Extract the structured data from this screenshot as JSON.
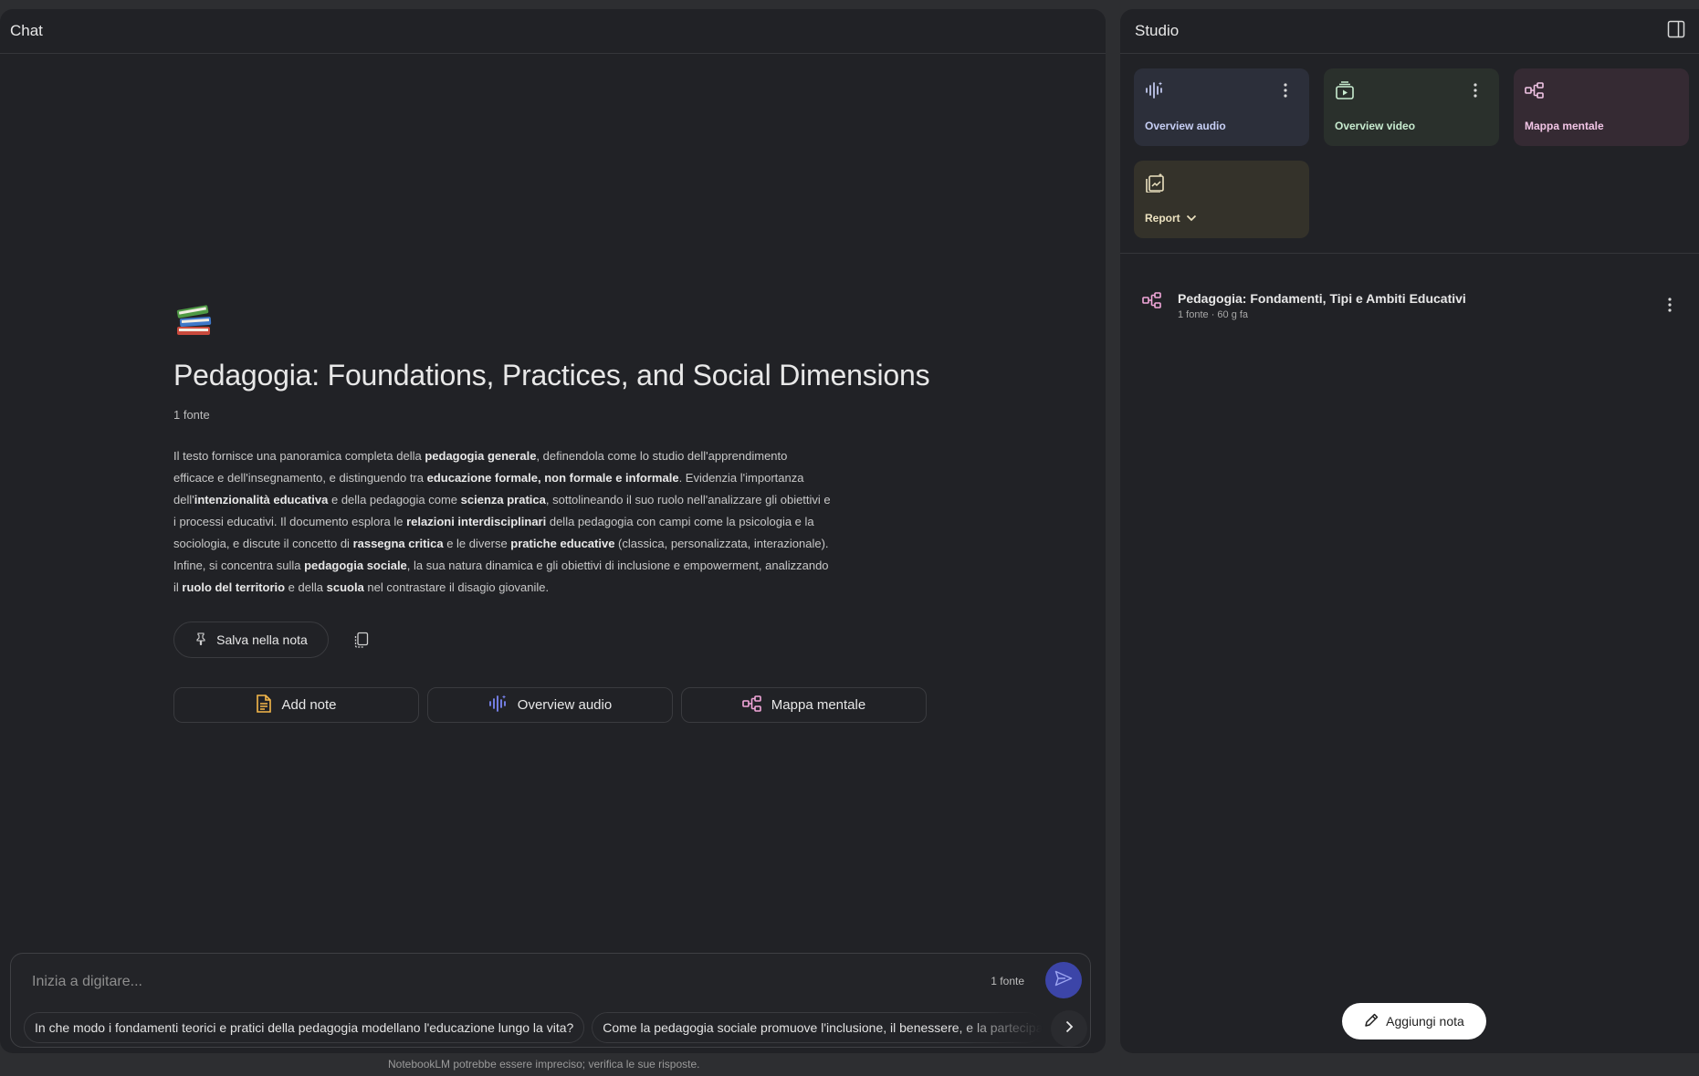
{
  "chat": {
    "header_title": "Chat",
    "notebook_title": "Pedagogia: Foundations, Practices, and Social Dimensions",
    "source_count": "1 fonte",
    "summary": [
      {
        "t": "Il testo fornisce una panoramica completa della ",
        "b": false
      },
      {
        "t": "pedagogia generale",
        "b": true
      },
      {
        "t": ", definendola come lo studio dell'apprendimento efficace e dell'insegnamento, e distinguendo tra ",
        "b": false
      },
      {
        "t": "educazione formale, non formale e informale",
        "b": true
      },
      {
        "t": ". Evidenzia l'importanza dell'",
        "b": false
      },
      {
        "t": "intenzionalità educativa",
        "b": true
      },
      {
        "t": " e della pedagogia come ",
        "b": false
      },
      {
        "t": "scienza pratica",
        "b": true
      },
      {
        "t": ", sottolineando il suo ruolo nell'analizzare gli obiettivi e i processi educativi. Il documento esplora le ",
        "b": false
      },
      {
        "t": "relazioni interdisciplinari",
        "b": true
      },
      {
        "t": " della pedagogia con campi come la psicologia e la sociologia, e discute il concetto di ",
        "b": false
      },
      {
        "t": "rassegna critica",
        "b": true
      },
      {
        "t": " e le diverse ",
        "b": false
      },
      {
        "t": "pratiche educative",
        "b": true
      },
      {
        "t": " (classica, personalizzata, interazionale). Infine, si concentra sulla ",
        "b": false
      },
      {
        "t": "pedagogia sociale",
        "b": true
      },
      {
        "t": ", la sua natura dinamica e gli obiettivi di inclusione e empowerment, analizzando il ",
        "b": false
      },
      {
        "t": "ruolo del territorio",
        "b": true
      },
      {
        "t": " e della ",
        "b": false
      },
      {
        "t": "scuola",
        "b": true
      },
      {
        "t": " nel contrastare il disagio giovanile.",
        "b": false
      }
    ],
    "save_note_label": "Salva nella nota",
    "actions": {
      "add_note": "Add note",
      "overview_audio": "Overview audio",
      "mappa_mentale": "Mappa mentale"
    },
    "composer": {
      "placeholder": "Inizia a digitare...",
      "sources": "1 fonte"
    },
    "suggestions": [
      "In che modo i fondamenti teorici e pratici della pedagogia modellano l'educazione lungo la vita?",
      "Come la pedagogia sociale promuove l'inclusione, il benessere, e la partecipazione"
    ]
  },
  "studio": {
    "header_title": "Studio",
    "tiles": {
      "audio": "Overview audio",
      "video": "Overview video",
      "mappa": "Mappa mentale",
      "report": "Report"
    },
    "note": {
      "title": "Pedagogia: Fondamenti, Tipi e Ambiti Educativi",
      "meta": "1 fonte · 60 g fa"
    },
    "add_note_label": "Aggiungi nota"
  },
  "footer": "NotebookLM potrebbe essere impreciso; verifica le sue risposte.",
  "colors": {
    "background": "#2d2e31",
    "panel": "#212226",
    "send_button": "#3c45a8",
    "audio_accent": "#7b86f5",
    "mind_map_accent": "#f2a7da",
    "note_accent": "#f5b84a"
  }
}
